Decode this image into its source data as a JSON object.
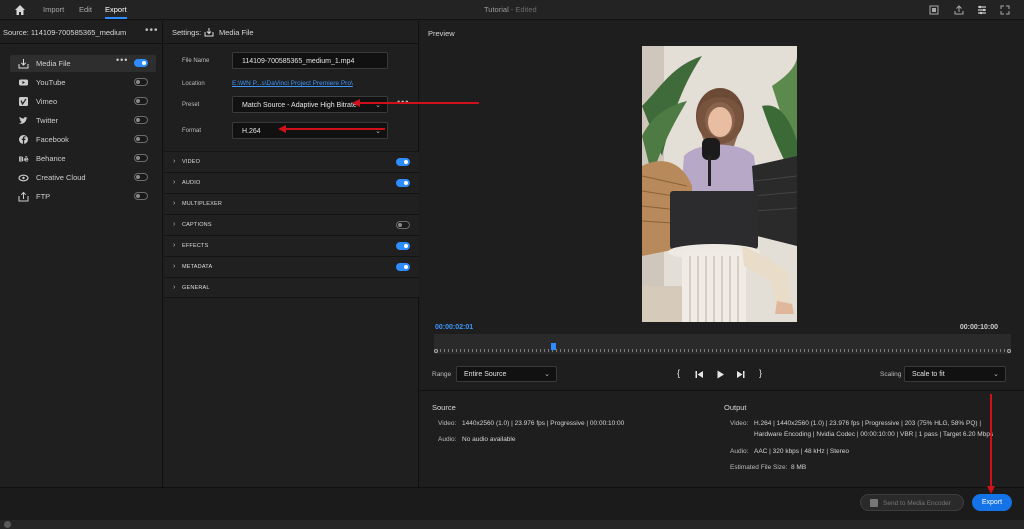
{
  "topbar": {
    "tabs": [
      {
        "label": "Import"
      },
      {
        "label": "Edit"
      },
      {
        "label": "Export"
      }
    ],
    "title": "Tutorial",
    "title_status": "- Edited"
  },
  "source": {
    "label": "Source:  114109-700585365_medium",
    "destinations": [
      {
        "label": "Media File",
        "icon": "media-file-icon",
        "on": true
      },
      {
        "label": "YouTube",
        "icon": "youtube-icon",
        "on": false
      },
      {
        "label": "Vimeo",
        "icon": "vimeo-icon",
        "on": false
      },
      {
        "label": "Twitter",
        "icon": "twitter-icon",
        "on": false
      },
      {
        "label": "Facebook",
        "icon": "facebook-icon",
        "on": false
      },
      {
        "label": "Behance",
        "icon": "behance-icon",
        "on": false
      },
      {
        "label": "Creative Cloud",
        "icon": "creative-cloud-icon",
        "on": false
      },
      {
        "label": "FTP",
        "icon": "ftp-icon",
        "on": false
      }
    ]
  },
  "settings": {
    "label": "Settings:",
    "target": "Media File",
    "file_name_label": "File Name",
    "file_name": "114109-700585365_medium_1.mp4",
    "location_label": "Location",
    "location": "E:\\WN P...s\\DaVinci Project Premiere Pro\\",
    "preset_label": "Preset",
    "preset": "Match Source - Adaptive High Bitrate",
    "format_label": "Format",
    "format": "H.264",
    "sections": [
      {
        "label": "VIDEO",
        "toggle": "on"
      },
      {
        "label": "AUDIO",
        "toggle": "on"
      },
      {
        "label": "MULTIPLEXER",
        "toggle": "none"
      },
      {
        "label": "CAPTIONS",
        "toggle": "off"
      },
      {
        "label": "EFFECTS",
        "toggle": "on"
      },
      {
        "label": "METADATA",
        "toggle": "on"
      },
      {
        "label": "GENERAL",
        "toggle": "none"
      }
    ]
  },
  "preview": {
    "label": "Preview",
    "timecode_current": "00:00:02:01",
    "timecode_end": "00:00:10:00",
    "playhead_fraction": 0.2,
    "range_label": "Range",
    "range_value": "Entire Source",
    "scaling_label": "Scaling",
    "scaling_value": "Scale to fit"
  },
  "source_info": {
    "heading": "Source",
    "video_label": "Video:",
    "video": "1440x2560 (1.0)  |  23.976 fps  |  Progressive  |  00:00:10:00",
    "audio_label": "Audio:",
    "audio": "No audio available"
  },
  "output_info": {
    "heading": "Output",
    "video_label": "Video:",
    "video_line1": "H.264  |  1440x2560 (1.0)  |  23.976 fps  |  Progressive  |  203 (75% HLG, 58% PQ)  |",
    "video_line2": "Hardware Encoding  |  Nvidia Codec  |  00:00:10:00  |  VBR  |  1 pass  |  Target 6.20 Mbps",
    "audio_label": "Audio:",
    "audio": "AAC  |  320 kbps  |  48 kHz  |  Stereo",
    "size_label": "Estimated File Size:",
    "size": "8 MB"
  },
  "bottom": {
    "send_label": "Send to Media Encoder",
    "export_label": "Export"
  },
  "colors": {
    "accent": "#2f8cff",
    "export_button": "#1473e6",
    "annotation": "#d0101a",
    "link": "#3d96ff"
  }
}
